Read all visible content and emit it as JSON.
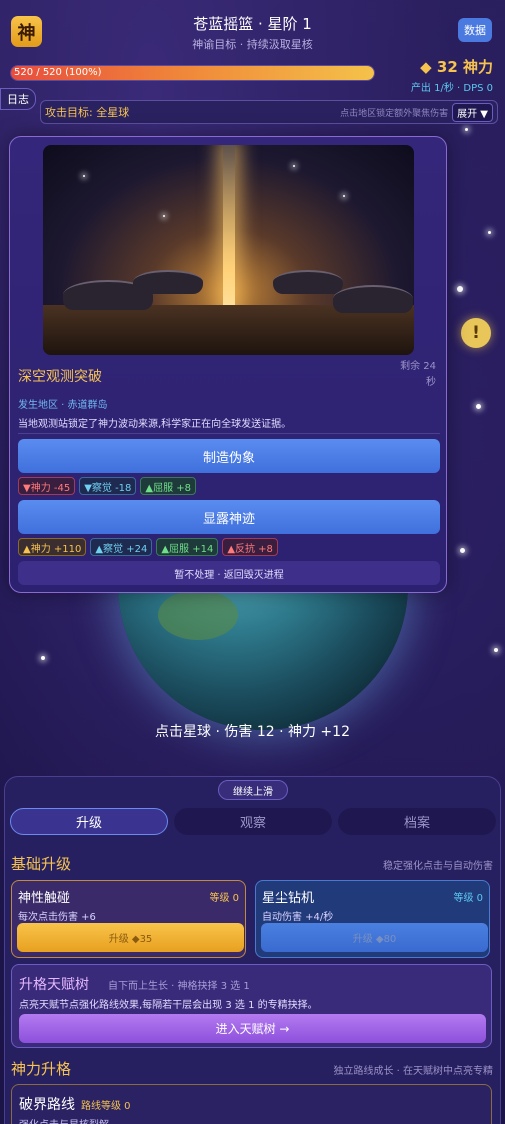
{
  "header": {
    "logo_char": "神",
    "title": "苍蓝摇篮 · 星阶 1",
    "subtitle": "神谕目标 · 持续汲取星核",
    "data_button": "数据"
  },
  "status": {
    "hp_text": "520 / 520 (100%)",
    "hp_fraction": 1.0,
    "power": "◆ 32 神力",
    "rate": "产出 1/秒 · DPS 0"
  },
  "log_button": "日志",
  "target_bar": {
    "label": "攻击目标: 全星球",
    "hint": "点击地区锁定额外聚焦伤害",
    "expand": "展开 ▼"
  },
  "alert_icon": "!",
  "event": {
    "title": "深空观测突破",
    "remaining": "剩余 24 秒",
    "region": "发生地区 · 赤道群岛",
    "description": "当地观测站锁定了神力波动来源,科学家正在向全球发送证据。",
    "option1": {
      "label": "制造伪象",
      "tags": [
        {
          "text": "▼神力 -45",
          "kind": "red"
        },
        {
          "text": "▼察觉 -18",
          "kind": "blue"
        },
        {
          "text": "▲屈服 +8",
          "kind": "green"
        }
      ]
    },
    "option2": {
      "label": "显露神迹",
      "tags": [
        {
          "text": "▲神力 +110",
          "kind": "gold"
        },
        {
          "text": "▲察觉 +24",
          "kind": "blue"
        },
        {
          "text": "▲屈服 +14",
          "kind": "green"
        },
        {
          "text": "▲反抗 +8",
          "kind": "red"
        }
      ]
    },
    "skip": "暂不处理 · 返回毁灭进程"
  },
  "hit_info": "点击星球 · 伤害 12 · 神力 +12",
  "panel": {
    "swipe": "继续上滑",
    "tabs": [
      "升级",
      "观察",
      "档案"
    ],
    "basic": {
      "title": "基础升级",
      "hint": "稳定强化点击与自动伤害",
      "cards": [
        {
          "name": "神性触碰",
          "level": "等级 0",
          "desc": "每次点击伤害 +6",
          "button": "升级 ◆35"
        },
        {
          "name": "星尘钻机",
          "level": "等级 0",
          "desc": "自动伤害 +4/秒",
          "button": "升级 ◆80"
        }
      ]
    },
    "talent": {
      "title": "升格天赋树",
      "sub": "自下而上生长 · 神格抉择 3 选 1",
      "desc": "点亮天赋节点强化路线效果,每隔若干层会出现 3 选 1 的专精抉择。",
      "button": "进入天赋树 →"
    },
    "divine": {
      "title": "神力升格",
      "hint": "独立路线成长 · 在天赋树中点亮专精"
    },
    "route": {
      "name": "破界路线",
      "level": "路线等级 0",
      "desc": "强化点击与星核裂解"
    }
  }
}
